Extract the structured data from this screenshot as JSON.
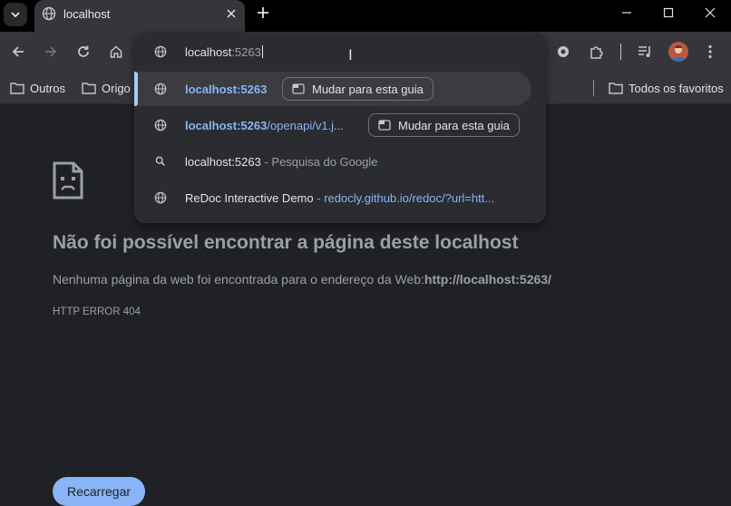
{
  "browser": {
    "tab": {
      "title": "localhost",
      "favicon": "globe-icon"
    },
    "window_controls": [
      "minimize-icon",
      "maximize-icon",
      "close-icon"
    ],
    "toolbar_icons": [
      "back-icon",
      "forward-icon",
      "reload-icon",
      "home-icon"
    ],
    "extension_icons": [
      "extension-puzzle-icon",
      "media-controls-icon",
      "profile-avatar",
      "more-icon"
    ]
  },
  "bookmarks": {
    "items": [
      {
        "label": "Outros"
      },
      {
        "label": "Origo"
      }
    ],
    "all_bookmarks": "Todos os favoritos"
  },
  "omnibox": {
    "input_host": "localhost",
    "input_suffix": ":5263",
    "suggestions": [
      {
        "icon": "globe-icon",
        "url_bold": "localhost:5263",
        "url_rest": "",
        "action": "Mudar para esta guia",
        "selected": true
      },
      {
        "icon": "globe-icon",
        "url_bold": "localhost:5263",
        "url_rest": "/openapi/v1.j...",
        "action": "Mudar para esta guia",
        "selected": false
      },
      {
        "icon": "search-icon",
        "text": "localhost:5263",
        "detail": " - Pesquisa do Google"
      },
      {
        "icon": "globe-icon",
        "text": "ReDoc Interactive Demo",
        "separator": " - ",
        "link": "redocly.github.io/redoc/?url=htt..."
      }
    ]
  },
  "error_page": {
    "title": "Não foi possível encontrar a página deste localhost",
    "description_prefix": "Nenhuma página da web foi encontrada para o endereço da Web:",
    "description_url": "http://localhost:5263/",
    "code": "HTTP ERROR 404",
    "reload_label": "Recarregar"
  },
  "colors": {
    "background": "#202124",
    "toolbar": "#35363a",
    "accent": "#8ab4f8",
    "muted_text": "#9aa0a6"
  }
}
